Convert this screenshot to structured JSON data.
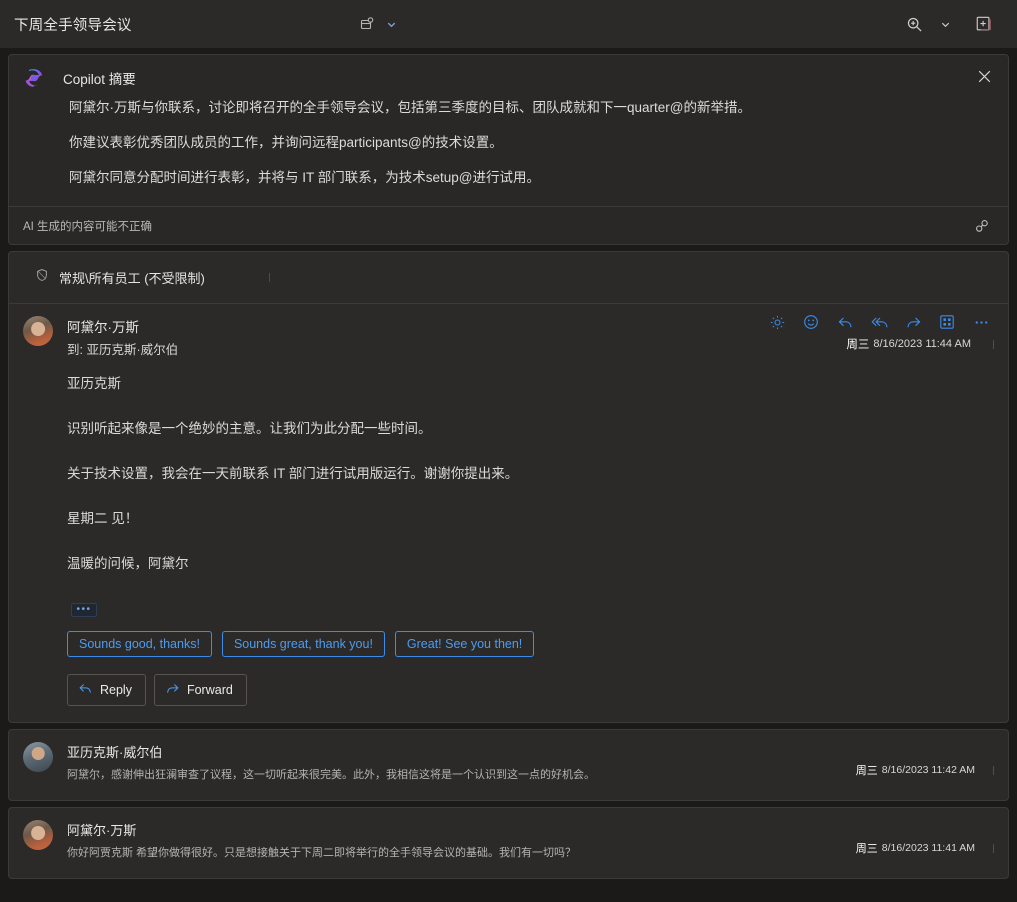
{
  "topbar": {
    "subject": "下周全手领导会议",
    "attachment_icon": "attachment-card-icon",
    "attachment_chevron": "chevron-down-icon",
    "zoom_icon": "zoom-in-icon",
    "zoom_chevron": "chevron-down-icon",
    "popout_icon": "open-in-new-window-icon"
  },
  "copilot": {
    "logo_icon": "copilot-logo-icon",
    "title": "Copilot 摘要",
    "close_icon": "close-icon",
    "paragraphs": [
      "阿黛尔·万斯与你联系，讨论即将召开的全手领导会议，包括第三季度的目标、团队成就和下一quarter@的新举措。",
      "你建议表彰优秀团队成员的工作，并询问远程participants@的技术设置。",
      "阿黛尔同意分配时间进行表彰，并将与 IT 部门联系，为技术setup@进行试用。"
    ],
    "disclaimer": "AI 生成的内容可能不正确",
    "link_icon": "link-icon"
  },
  "sensitivity": {
    "icon": "sensitivity-shield-icon",
    "label": "常规\\所有员工 (不受限制)"
  },
  "message": {
    "avatar": "adele-avatar",
    "sender": "阿黛尔·万斯",
    "to_line": "到: 亚历克斯·威尔伯",
    "timestamp_day": "周三",
    "timestamp": "8/16/2023  11:44 AM",
    "actions": [
      {
        "name": "brightness-icon",
        "label": "brightness"
      },
      {
        "name": "emoji-icon",
        "label": "emoji"
      },
      {
        "name": "reply-icon",
        "label": "reply"
      },
      {
        "name": "reply-all-icon",
        "label": "reply all"
      },
      {
        "name": "forward-icon",
        "label": "forward"
      },
      {
        "name": "apps-grid-icon",
        "label": "apps"
      },
      {
        "name": "more-options-icon",
        "label": "more"
      }
    ],
    "body": [
      "亚历克斯",
      "识别听起来像是一个绝妙的主意。让我们为此分配一些时间。",
      "关于技术设置，我会在一天前联系 IT 部门进行试用版运行。谢谢你提出来。",
      "星期二 见！",
      "温暖的问候，阿黛尔"
    ],
    "expand_ellipsis": "•••",
    "suggested_replies": [
      "Sounds good, thanks!",
      "Sounds great, thank you!",
      "Great! See you then!"
    ],
    "reply_button": {
      "label": "Reply",
      "icon": "reply-icon"
    },
    "forward_button": {
      "label": "Forward",
      "icon": "forward-icon"
    }
  },
  "collapsed_messages": [
    {
      "avatar": "alex-avatar",
      "sender": "亚历克斯·威尔伯",
      "preview": "阿黛尔，感谢伸出狂澜审查了议程，这一切听起来很完美。此外，我相信这将是一个认识到这一点的好机会。",
      "timestamp_day": "周三",
      "timestamp": "8/16/2023  11:42 AM"
    },
    {
      "avatar": "adele-avatar",
      "sender": "阿黛尔·万斯",
      "preview": "你好阿贾克斯 希望你做得很好。只是想接触关于下周二即将举行的全手领导会议的基础。我们有一切吗？",
      "timestamp_day": "周三",
      "timestamp": "8/16/2023  11:41 AM"
    }
  ],
  "colors": {
    "page_bg": "#1b1a19",
    "card_bg": "#2b2a29",
    "copilot_card_bg": "#292827",
    "border": "#3b3a39",
    "accent_blue": "#3b8ceb",
    "text_primary": "#e8e6e3",
    "text_secondary": "#b6b4b1"
  }
}
